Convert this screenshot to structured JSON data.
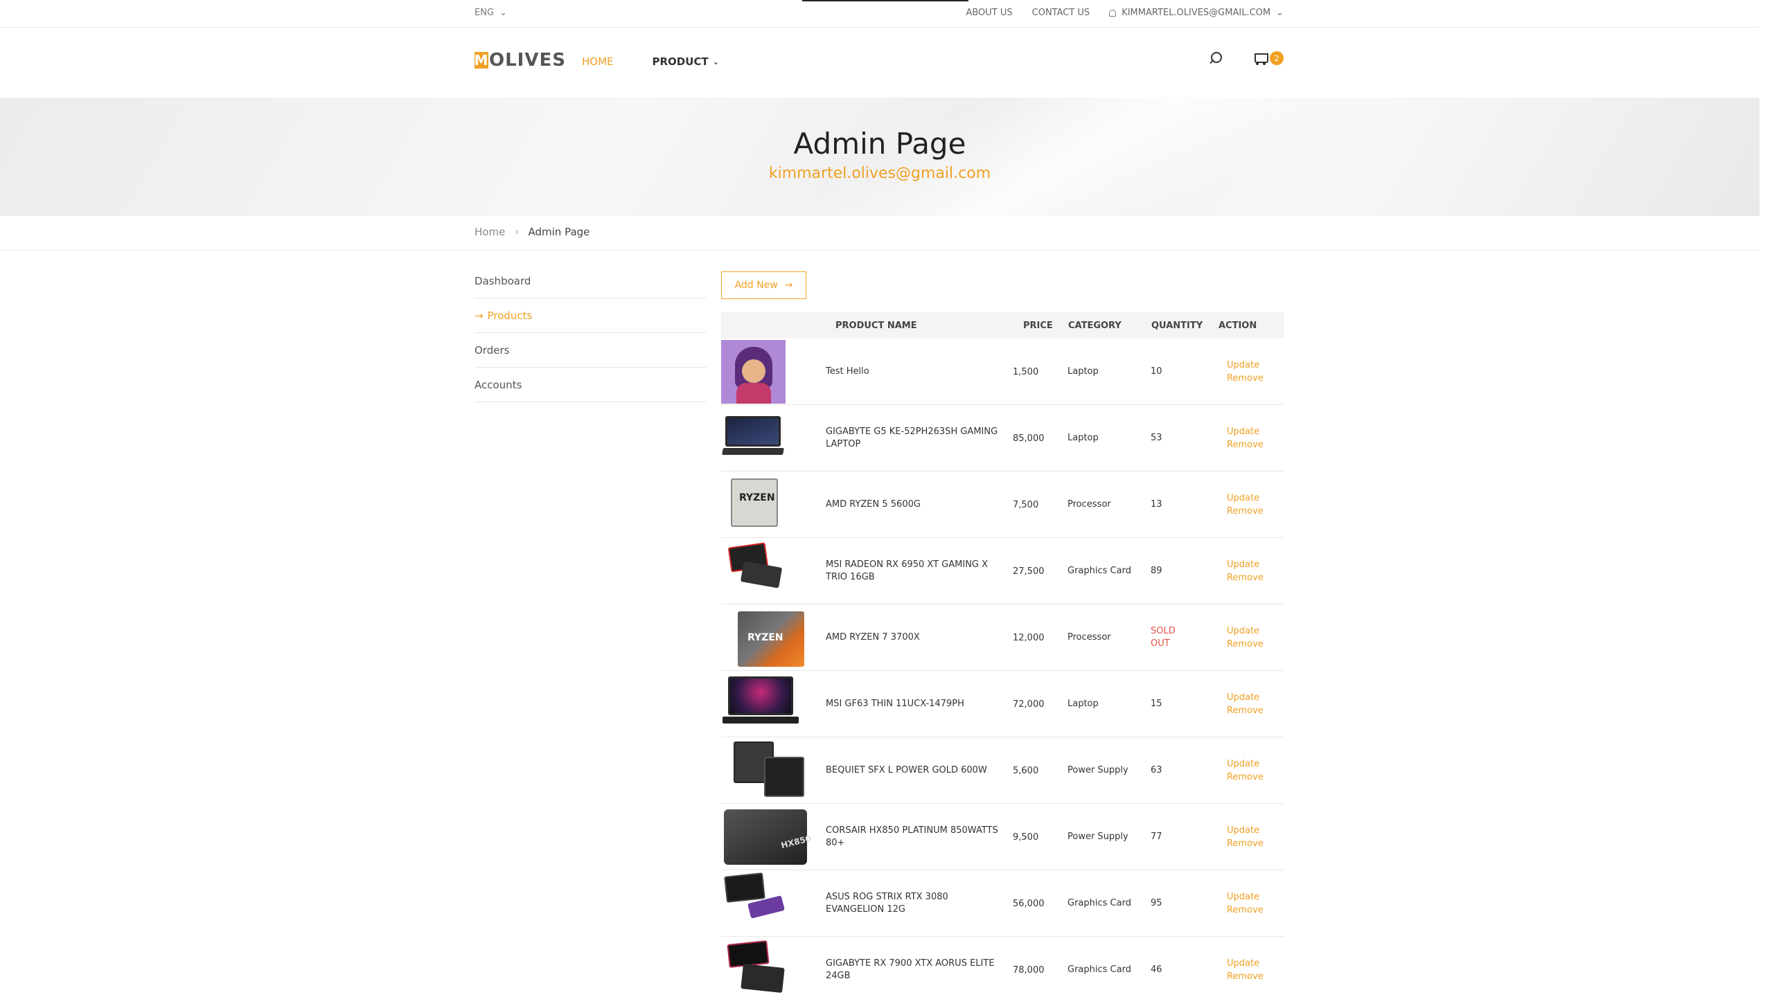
{
  "topbar": {
    "language": "ENG",
    "links": [
      "ABOUT US",
      "CONTACT US"
    ],
    "user_email": "KIMMARTEL.OLIVES@GMAIL.COM"
  },
  "header": {
    "logo_text": "OLIVES",
    "nav": {
      "home": "HOME",
      "product": "PRODUCT"
    },
    "cart_count": "2"
  },
  "banner": {
    "title": "Admin Page",
    "subtitle": "kimmartel.olives@gmail.com"
  },
  "breadcrumb": {
    "home": "Home",
    "current": "Admin Page"
  },
  "sidebar": {
    "items": [
      {
        "label": "Dashboard"
      },
      {
        "label": "Products"
      },
      {
        "label": "Orders"
      },
      {
        "label": "Accounts"
      }
    ]
  },
  "main": {
    "add_new_label": "Add New",
    "columns": {
      "product_name": "PRODUCT NAME",
      "price": "PRICE",
      "category": "CATEGORY",
      "quantity": "QUANTITY",
      "action": "ACTION"
    },
    "update_label": "Update",
    "remove_label": "Remove",
    "products": [
      {
        "name": "Test Hello",
        "price": "1,500",
        "category": "Laptop",
        "quantity": "10"
      },
      {
        "name": "GIGABYTE G5 KE-52PH263SH GAMING LAPTOP",
        "price": "85,000",
        "category": "Laptop",
        "quantity": "53"
      },
      {
        "name": "AMD RYZEN 5 5600G",
        "price": "7,500",
        "category": "Processor",
        "quantity": "13"
      },
      {
        "name": "MSI RADEON RX 6950 XT GAMING X TRIO 16GB",
        "price": "27,500",
        "category": "Graphics Card",
        "quantity": "89"
      },
      {
        "name": "AMD RYZEN 7 3700X",
        "price": "12,000",
        "category": "Processor",
        "quantity": "SOLD OUT"
      },
      {
        "name": "MSI GF63 THIN 11UCX-1479PH",
        "price": "72,000",
        "category": "Laptop",
        "quantity": "15"
      },
      {
        "name": "BEQUIET SFX L POWER GOLD 600W",
        "price": "5,600",
        "category": "Power Supply",
        "quantity": "63"
      },
      {
        "name": "CORSAIR HX850 PLATINUM 850WATTS 80+",
        "price": "9,500",
        "category": "Power Supply",
        "quantity": "77"
      },
      {
        "name": "ASUS ROG STRIX RTX 3080 EVANGELION 12G",
        "price": "56,000",
        "category": "Graphics Card",
        "quantity": "95"
      },
      {
        "name": "GIGABYTE RX 7900 XTX AORUS ELITE 24GB",
        "price": "78,000",
        "category": "Graphics Card",
        "quantity": "46"
      }
    ]
  },
  "colors": {
    "accent": "#f0a023",
    "sold_out": "#e8534a"
  }
}
